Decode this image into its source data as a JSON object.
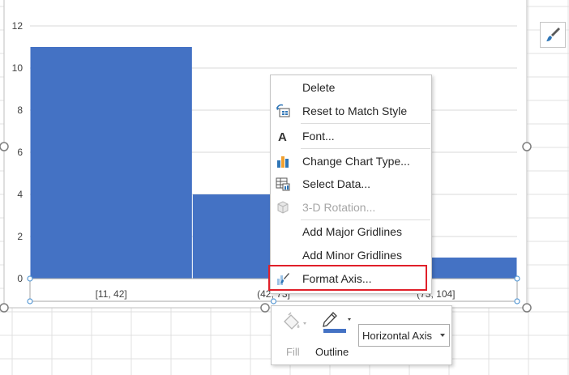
{
  "chart_data": {
    "type": "bar",
    "subtype": "histogram",
    "categories": [
      "[11, 42]",
      "(42, 73]",
      "(73, 104]"
    ],
    "values": [
      11,
      4,
      1
    ],
    "ylim": [
      0,
      12
    ],
    "yticks": [
      0,
      2,
      4,
      6,
      8,
      10,
      12
    ],
    "grid": true,
    "bar_color": "#4472C4",
    "gridline_color": "#d9d9d9"
  },
  "context_menu": {
    "items": [
      {
        "label": "Delete",
        "icon": "none",
        "disabled": false
      },
      {
        "label": "Reset to Match Style",
        "icon": "reset-style-icon",
        "disabled": false
      },
      {
        "label": "Font...",
        "icon": "font-icon",
        "disabled": false
      },
      {
        "label": "Change Chart Type...",
        "icon": "chart-type-icon",
        "disabled": false
      },
      {
        "label": "Select Data...",
        "icon": "select-data-icon",
        "disabled": false
      },
      {
        "label": "3-D Rotation...",
        "icon": "cube-icon",
        "disabled": true
      },
      {
        "label": "Add Major Gridlines",
        "icon": "none",
        "disabled": false
      },
      {
        "label": "Add Minor Gridlines",
        "icon": "none",
        "disabled": false
      },
      {
        "label": "Format Axis...",
        "icon": "format-axis-icon",
        "disabled": false
      }
    ],
    "highlighted_item": "Format Axis..."
  },
  "mini_toolbar": {
    "fill_label": "Fill",
    "outline_label": "Outline",
    "element_select": "Horizontal Axis",
    "outline_color": "#4472C4"
  },
  "colors": {
    "highlight_border": "#e0202a",
    "handle_stroke": "#7f7f7f",
    "selection_handle": "#5b9bd5"
  }
}
